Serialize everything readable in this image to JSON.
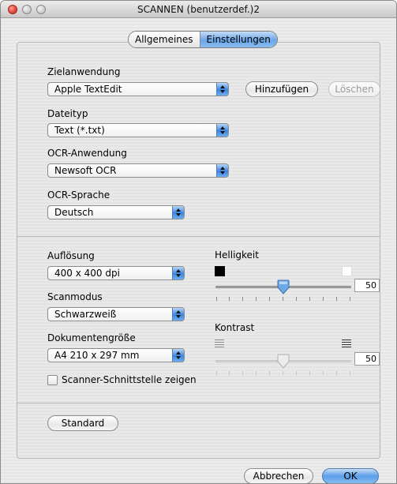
{
  "window": {
    "title": "SCANNEN (benutzerdef.)2"
  },
  "tabs": [
    {
      "label": "Allgemeines",
      "active": false
    },
    {
      "label": "Einstellungen",
      "active": true
    }
  ],
  "app_section": {
    "target_app_label": "Zielanwendung",
    "target_app_value": "Apple TextEdit",
    "add_button": "Hinzufügen",
    "delete_button": "Löschen",
    "file_type_label": "Dateityp",
    "file_type_value": "Text (*.txt)",
    "ocr_app_label": "OCR-Anwendung",
    "ocr_app_value": "Newsoft OCR",
    "ocr_lang_label": "OCR-Sprache",
    "ocr_lang_value": "Deutsch"
  },
  "scan_section": {
    "resolution_label": "Auflösung",
    "resolution_value": "400 x 400 dpi",
    "scan_mode_label": "Scanmodus",
    "scan_mode_value": "Schwarzweiß",
    "doc_size_label": "Dokumentengröße",
    "doc_size_value": "A4  210 x 297 mm",
    "scanner_ui_checkbox_label": "Scanner-Schnittstelle zeigen",
    "scanner_ui_checked": false,
    "brightness_label": "Helligkeit",
    "brightness_value": "50",
    "contrast_label": "Kontrast",
    "contrast_value": "50",
    "contrast_enabled": false
  },
  "standard_button": "Standard",
  "footer": {
    "cancel_button": "Abbrechen",
    "ok_button": "OK"
  },
  "colors": {
    "accent_blue": "#5b9ee8",
    "window_bg": "#e9e9e9",
    "close_red": "#e0443a"
  }
}
